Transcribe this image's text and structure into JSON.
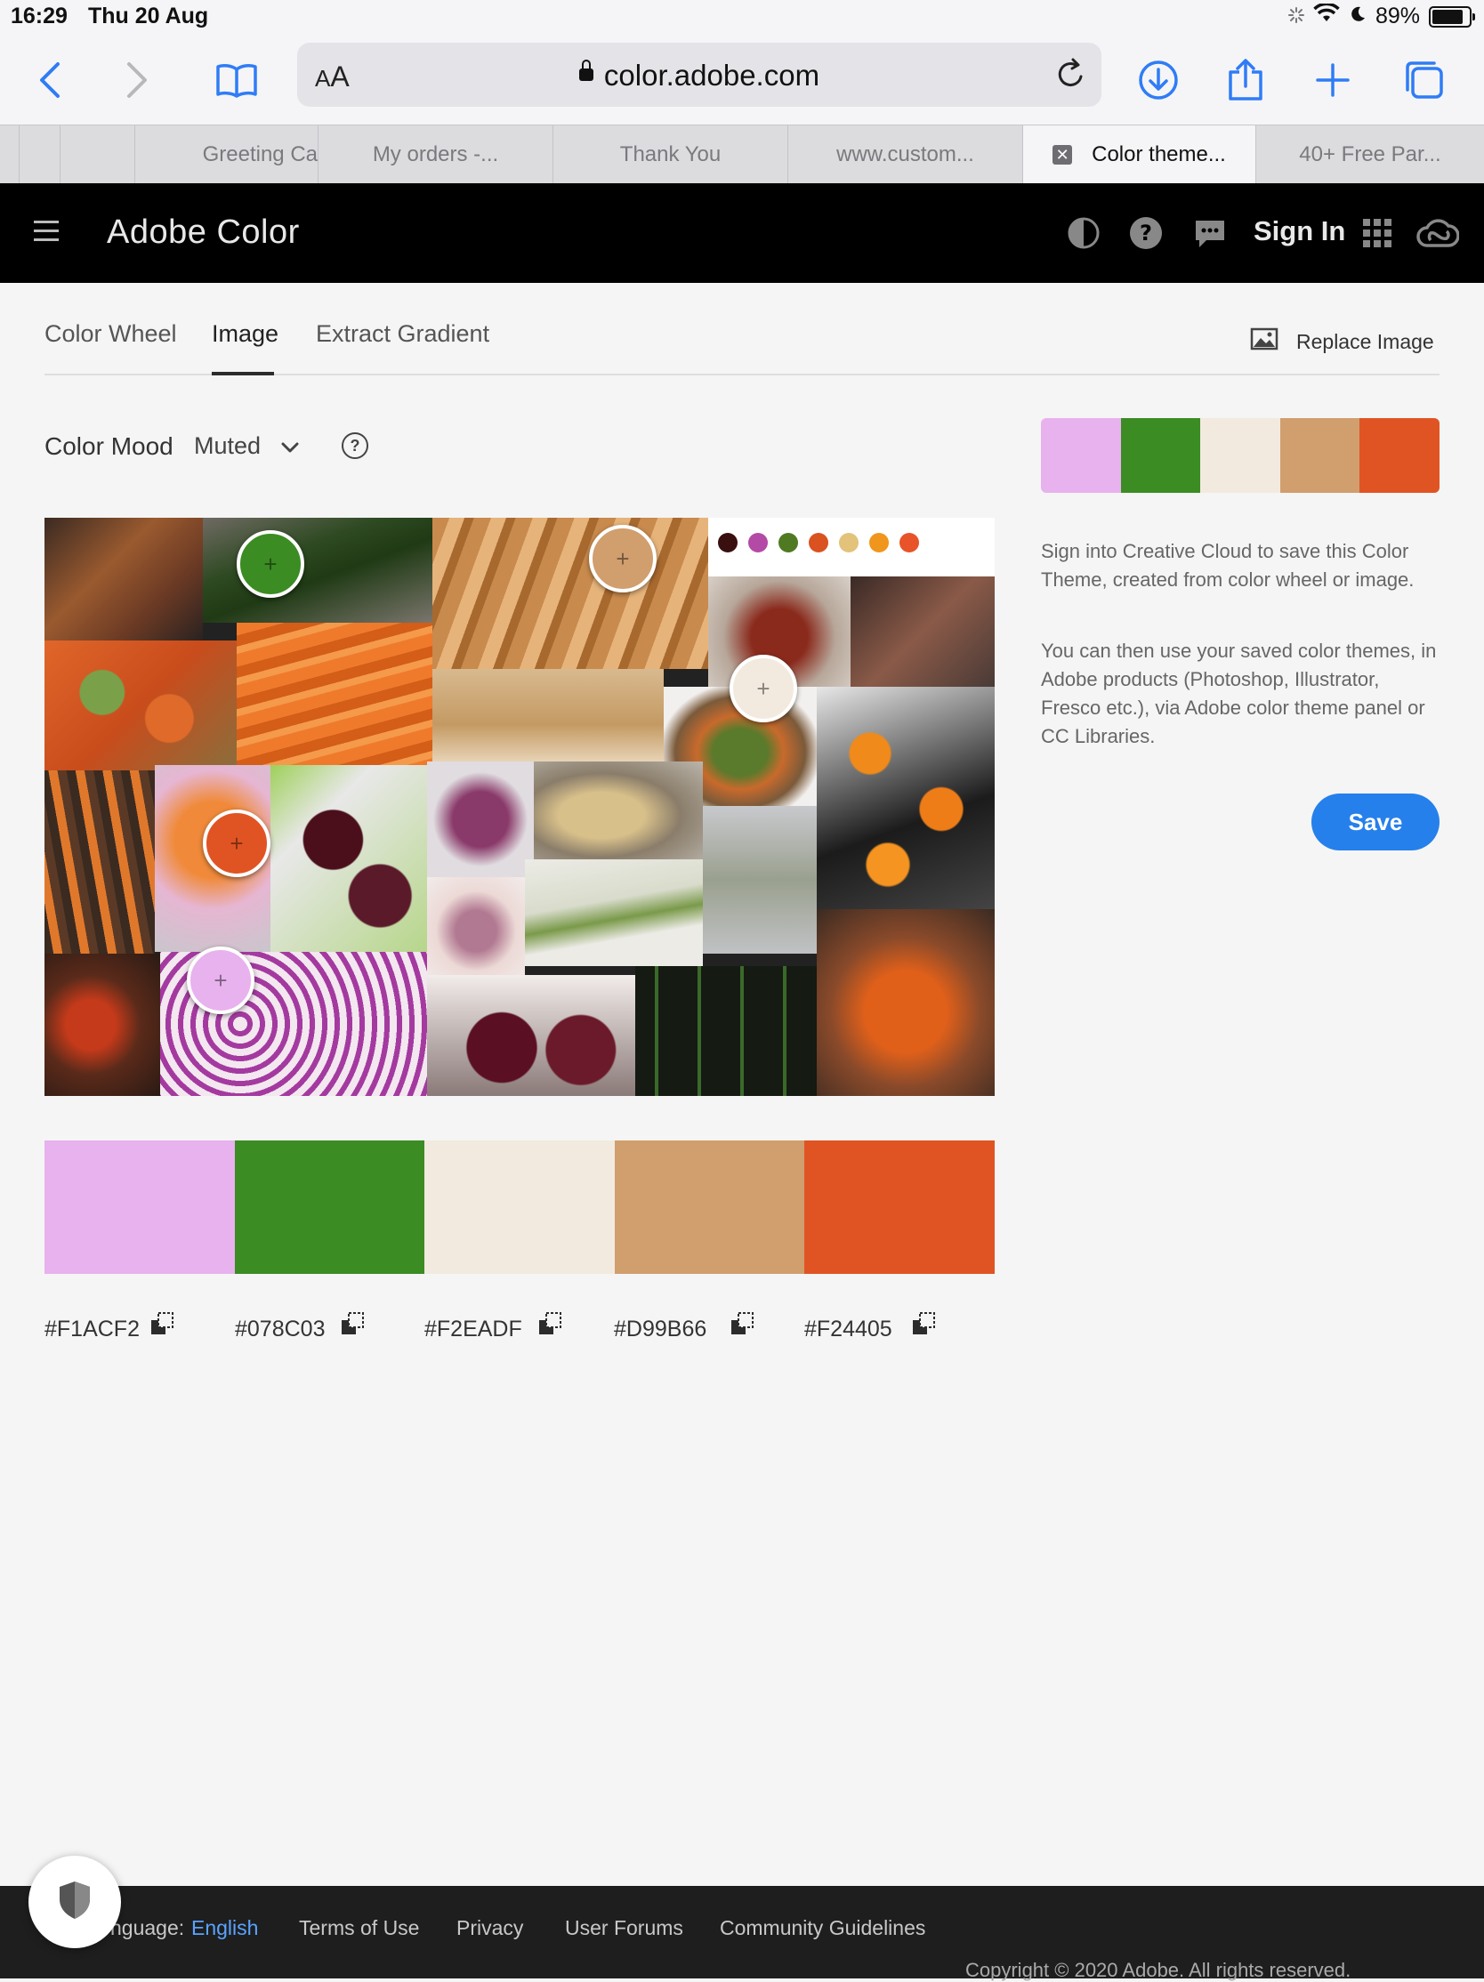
{
  "status_bar": {
    "time": "16:29",
    "date": "Thu 20 Aug",
    "battery": "89%"
  },
  "browser": {
    "url": "color.adobe.com",
    "aa_small": "A",
    "aa_big": "A",
    "tabs": [
      {
        "label": ""
      },
      {
        "label": ""
      },
      {
        "label": "Greeting Ca"
      },
      {
        "label": "My orders -..."
      },
      {
        "label": "Thank You"
      },
      {
        "label": "www.custom..."
      },
      {
        "label": "Color theme..."
      },
      {
        "label": "40+ Free Par..."
      }
    ]
  },
  "app": {
    "brand": "Adobe Color",
    "sign_in": "Sign In"
  },
  "page_tabs": {
    "wheel": "Color Wheel",
    "image": "Image",
    "gradient": "Extract Gradient",
    "replace_image": "Replace Image"
  },
  "mood": {
    "label": "Color Mood",
    "value": "Muted",
    "help": "?"
  },
  "picker_symbol": "+",
  "colors": {
    "c1": "#E8B2EE",
    "c2": "#3B8C23",
    "c3": "#F2EADF",
    "c4": "#D19E6E",
    "c5": "#E05423"
  },
  "hex_codes": [
    "#F1ACF2",
    "#078C03",
    "#F2EADF",
    "#D99B66",
    "#F24405"
  ],
  "sidebar": {
    "info1": "Sign into Creative Cloud to save this Color Theme, created from color wheel or image.",
    "info2": "You can then use your saved color themes, in Adobe products (Photoshop, Illustrator, Fresco etc.), via Adobe color theme panel or CC Libraries.",
    "save": "Save"
  },
  "footer": {
    "language_label": "nguage:",
    "language_value": "English",
    "terms": "Terms of Use",
    "privacy": "Privacy",
    "forums": "User Forums",
    "guidelines": "Community Guidelines",
    "copyright": "Copyright © 2020 Adobe. All rights reserved."
  }
}
